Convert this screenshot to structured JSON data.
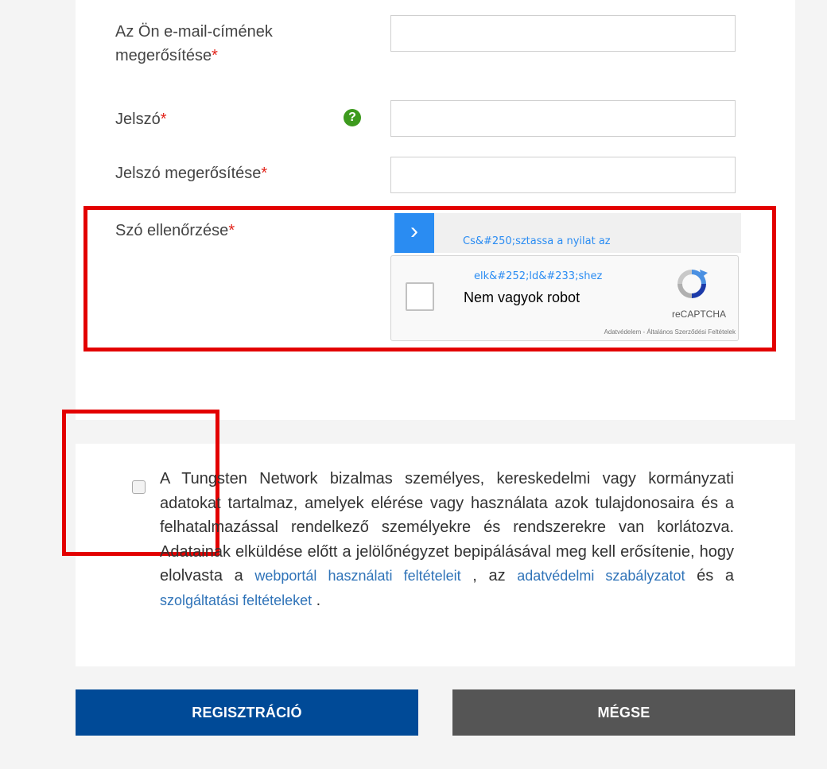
{
  "form": {
    "confirm_email_label_line1": "Az Ön e-mail-címének",
    "confirm_email_label_line2": "megerősítése",
    "password_label": "Jelszó",
    "password_confirm_label": "Jelszó megerősítése",
    "word_check_label": "Szó ellenőrzése",
    "required_mark": "*",
    "help_icon_glyph": "?"
  },
  "captcha": {
    "arrow_glyph": "›",
    "hint_line1": "Cs&#250;sztassa a nyilat az",
    "hint_line2": "elk&#252;ld&#233;shez",
    "checkbox_label": "Nem vagyok robot",
    "brand": "reCAPTCHA",
    "privacy_link": "Adatvédelem",
    "separator": " - ",
    "terms_link": "Általános Szerződési Feltételek"
  },
  "terms": {
    "text_part1": "A Tungsten Network bizalmas személyes, kereskedelmi vagy kormányzati adatokat tartalmaz, amelyek elérése vagy használata azok tulajdonosaira és a felhatalmazással rendelkező személyekre és rendszerekre van korlátozva. Adatainak elküldése előtt a jelölőnégyzet bepipálásával meg kell erősítenie, hogy elolvasta a ",
    "link1": "webportál használati feltételeit",
    "text_part2": " , az ",
    "link2": "adatvédelmi szabályzatot",
    "text_part3": " és a ",
    "link3": "szolgáltatási feltételeket",
    "text_part4": " ."
  },
  "buttons": {
    "register": "REGISZTRÁCIÓ",
    "cancel": "MÉGSE"
  },
  "colors": {
    "primary_button": "#004a97",
    "secondary_button": "#555555",
    "required": "#e2231a",
    "highlight": "#e30000",
    "link": "#2f73b8",
    "captcha_blue": "#2a8cf2"
  }
}
